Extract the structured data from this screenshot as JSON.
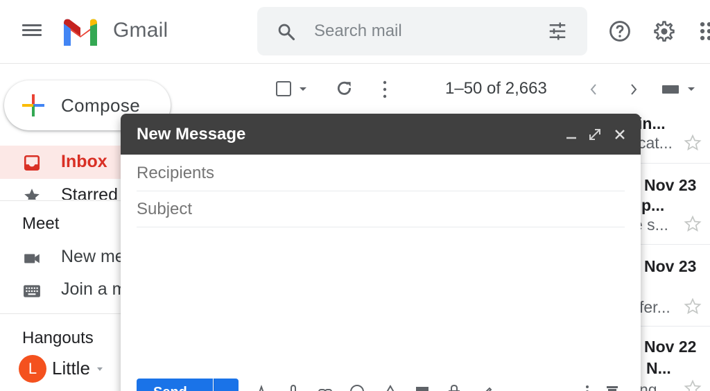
{
  "header": {
    "app_name": "Gmail",
    "search_placeholder": "Search mail",
    "icons": [
      "menu-icon",
      "gmail-logo",
      "search-icon",
      "tune-icon",
      "help-icon",
      "gear-icon",
      "apps-icon"
    ]
  },
  "sidebar": {
    "compose_label": "Compose",
    "items": [
      {
        "label": "Inbox",
        "icon": "inbox-icon",
        "active": true
      },
      {
        "label": "Starred",
        "icon": "star-icon",
        "active": false
      }
    ],
    "meet": {
      "title": "Meet",
      "items": [
        {
          "label": "New meeting",
          "icon": "video-icon"
        },
        {
          "label": "Join a meeting",
          "icon": "keyboard-icon"
        }
      ]
    },
    "hangouts": {
      "title": "Hangouts",
      "user_initial": "L",
      "user_name": "Little"
    }
  },
  "toolbar": {
    "page_count": "1–50 of 2,663"
  },
  "email_list": {
    "rows": [
      {
        "sender": "in...",
        "date": "",
        "snippet": "cat..."
      },
      {
        "sender": "p...",
        "date": "Nov 23",
        "snippet": "e s..."
      },
      {
        "sender": "",
        "date": "Nov 23",
        "snippet": "fer..."
      },
      {
        "sender": "N...",
        "date": "Nov 22",
        "snippet": "ng"
      }
    ]
  },
  "compose_window": {
    "title": "New Message",
    "recipients_placeholder": "Recipients",
    "subject_placeholder": "Subject",
    "send_label": "Send"
  },
  "colors": {
    "accent_red": "#d93025",
    "active_bg": "#fce8e6",
    "send_blue": "#1a73e8",
    "compose_header": "#404040",
    "avatar": "#f4511e"
  }
}
